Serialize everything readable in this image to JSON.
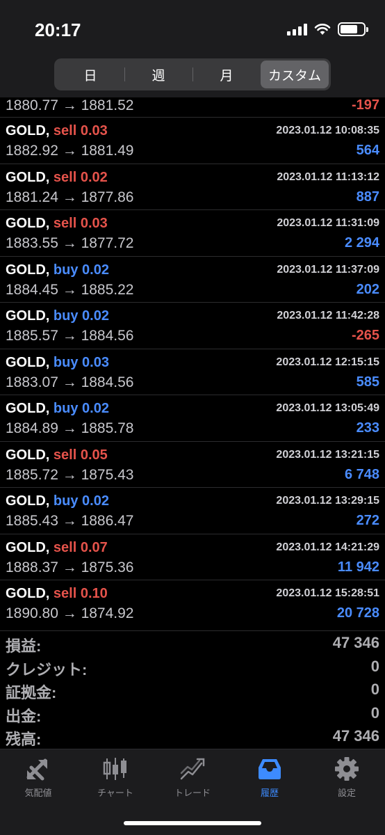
{
  "status_bar": {
    "time": "20:17"
  },
  "period_tabs": [
    {
      "label": "日",
      "active": false
    },
    {
      "label": "週",
      "active": false
    },
    {
      "label": "月",
      "active": false
    },
    {
      "label": "カスタム",
      "active": true
    }
  ],
  "partial_deal": {
    "prices": "1880.77 → 1881.52",
    "profit": "-197"
  },
  "deals": [
    {
      "symbol": "GOLD,",
      "side": "sell 0.03",
      "type": "sell",
      "datetime": "2023.01.12 10:08:35",
      "prices": "1882.92 → 1881.49",
      "profit": "564",
      "sign": "pos"
    },
    {
      "symbol": "GOLD,",
      "side": "sell 0.02",
      "type": "sell",
      "datetime": "2023.01.12 11:13:12",
      "prices": "1881.24 → 1877.86",
      "profit": "887",
      "sign": "pos"
    },
    {
      "symbol": "GOLD,",
      "side": "sell 0.03",
      "type": "sell",
      "datetime": "2023.01.12 11:31:09",
      "prices": "1883.55 → 1877.72",
      "profit": "2 294",
      "sign": "pos"
    },
    {
      "symbol": "GOLD,",
      "side": "buy 0.02",
      "type": "buy",
      "datetime": "2023.01.12 11:37:09",
      "prices": "1884.45 → 1885.22",
      "profit": "202",
      "sign": "pos"
    },
    {
      "symbol": "GOLD,",
      "side": "buy 0.02",
      "type": "buy",
      "datetime": "2023.01.12 11:42:28",
      "prices": "1885.57 → 1884.56",
      "profit": "-265",
      "sign": "neg"
    },
    {
      "symbol": "GOLD,",
      "side": "buy 0.03",
      "type": "buy",
      "datetime": "2023.01.12 12:15:15",
      "prices": "1883.07 → 1884.56",
      "profit": "585",
      "sign": "pos"
    },
    {
      "symbol": "GOLD,",
      "side": "buy 0.02",
      "type": "buy",
      "datetime": "2023.01.12 13:05:49",
      "prices": "1884.89 → 1885.78",
      "profit": "233",
      "sign": "pos"
    },
    {
      "symbol": "GOLD,",
      "side": "sell 0.05",
      "type": "sell",
      "datetime": "2023.01.12 13:21:15",
      "prices": "1885.72 → 1875.43",
      "profit": "6 748",
      "sign": "pos"
    },
    {
      "symbol": "GOLD,",
      "side": "buy 0.02",
      "type": "buy",
      "datetime": "2023.01.12 13:29:15",
      "prices": "1885.43 → 1886.47",
      "profit": "272",
      "sign": "pos"
    },
    {
      "symbol": "GOLD,",
      "side": "sell 0.07",
      "type": "sell",
      "datetime": "2023.01.12 14:21:29",
      "prices": "1888.37 → 1875.36",
      "profit": "11 942",
      "sign": "pos"
    },
    {
      "symbol": "GOLD,",
      "side": "sell 0.10",
      "type": "sell",
      "datetime": "2023.01.12 15:28:51",
      "prices": "1890.80 → 1874.92",
      "profit": "20 728",
      "sign": "pos"
    }
  ],
  "summary": [
    {
      "label": "損益:",
      "value": "47 346"
    },
    {
      "label": "クレジット:",
      "value": "0"
    },
    {
      "label": "証拠金:",
      "value": "0"
    },
    {
      "label": "出金:",
      "value": "0"
    },
    {
      "label": "残高:",
      "value": "47 346"
    }
  ],
  "tabbar": [
    {
      "label": "気配値",
      "icon": "quotes-icon",
      "active": false
    },
    {
      "label": "チャート",
      "icon": "chart-icon",
      "active": false
    },
    {
      "label": "トレード",
      "icon": "trade-icon",
      "active": false
    },
    {
      "label": "履歴",
      "icon": "history-icon",
      "active": true
    },
    {
      "label": "設定",
      "icon": "settings-icon",
      "active": false
    }
  ],
  "colors": {
    "sell": "#e5534b",
    "buy": "#4a8cff",
    "profit_positive": "#4a8cff",
    "profit_negative": "#e5534b",
    "active_tab": "#3d8bff"
  }
}
